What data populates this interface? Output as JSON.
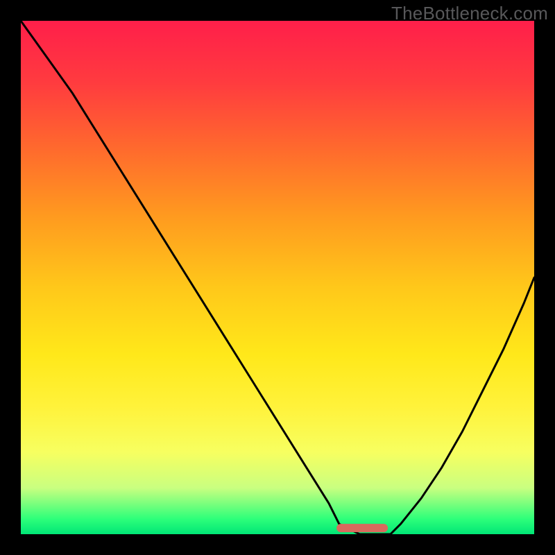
{
  "watermark": "TheBottleneck.com",
  "chart_data": {
    "type": "line",
    "title": "",
    "xlabel": "",
    "ylabel": "",
    "x": [
      0.0,
      0.05,
      0.1,
      0.15,
      0.2,
      0.25,
      0.3,
      0.35,
      0.4,
      0.45,
      0.5,
      0.55,
      0.6,
      0.62,
      0.66,
      0.7,
      0.72,
      0.74,
      0.78,
      0.82,
      0.86,
      0.9,
      0.94,
      0.98,
      1.0
    ],
    "values": [
      1.0,
      0.93,
      0.86,
      0.78,
      0.7,
      0.62,
      0.54,
      0.46,
      0.38,
      0.3,
      0.22,
      0.14,
      0.06,
      0.02,
      0.0,
      0.0,
      0.0,
      0.02,
      0.07,
      0.13,
      0.2,
      0.28,
      0.36,
      0.45,
      0.5
    ],
    "xlim": [
      0,
      1
    ],
    "ylim": [
      0,
      1
    ],
    "plateau": {
      "x_start": 0.615,
      "x_end": 0.715,
      "y": 0.012
    },
    "plateau_color": "#d86a5d",
    "curve_color": "#000000",
    "background_gradient": [
      "#ff1f4a",
      "#ffe81a",
      "#00e676"
    ]
  }
}
